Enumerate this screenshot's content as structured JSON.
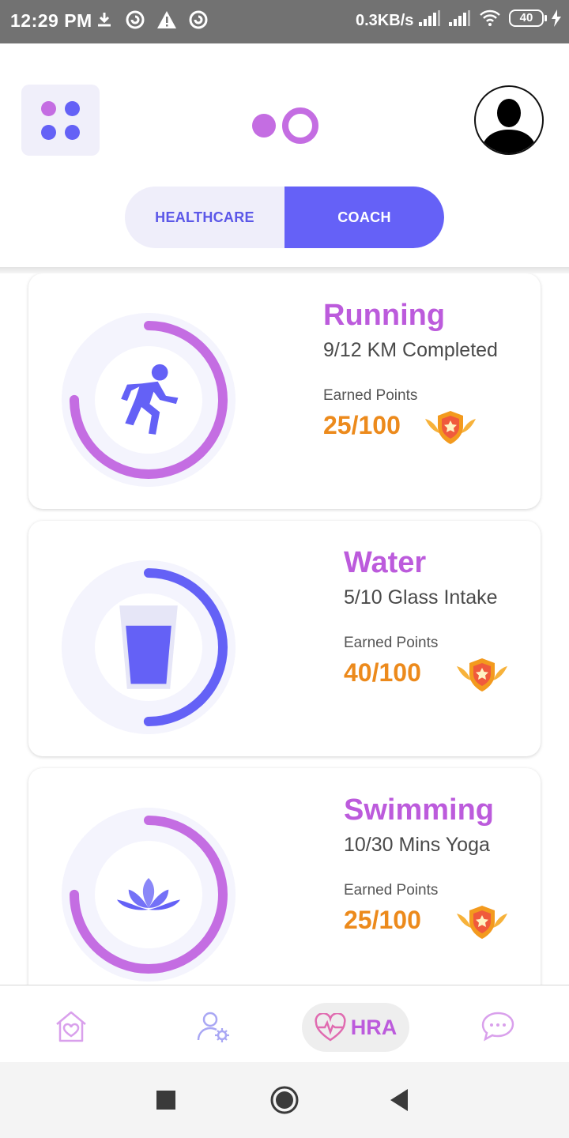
{
  "status_bar": {
    "time": "12:29 PM",
    "net_speed": "0.3KB/s",
    "battery": "40"
  },
  "header": {
    "menu_icon": "grid-dots-icon",
    "logo": "app-logo",
    "avatar": "user-avatar-icon"
  },
  "toggle": {
    "left_label": "HEALTHCARE",
    "right_label": "COACH",
    "selected": "COACH"
  },
  "cards": [
    {
      "title": "Running",
      "subtitle": "9/12 KM Completed",
      "earned_label": "Earned Points",
      "points": "25/100",
      "progress": 0.75,
      "ring_color": "#c46de2",
      "icon": "runner-icon"
    },
    {
      "title": "Water",
      "subtitle": "5/10 Glass Intake",
      "earned_label": "Earned Points",
      "points": "40/100",
      "progress": 0.5,
      "ring_color": "#6461f6",
      "icon": "water-glass-icon"
    },
    {
      "title": "Swimming",
      "subtitle": "10/30 Mins Yoga",
      "earned_label": "Earned Points",
      "points": "25/100",
      "progress": 0.75,
      "ring_color": "#c46de2",
      "icon": "lotus-icon"
    }
  ],
  "bottom_nav": {
    "items": [
      "home-heart-icon",
      "user-settings-icon",
      "heartbeat-icon",
      "chat-icon"
    ],
    "active_label": "HRA"
  },
  "colors": {
    "accent_purple": "#bc5bdc",
    "accent_indigo": "#6561f7",
    "points_orange": "#ec8a1c"
  }
}
